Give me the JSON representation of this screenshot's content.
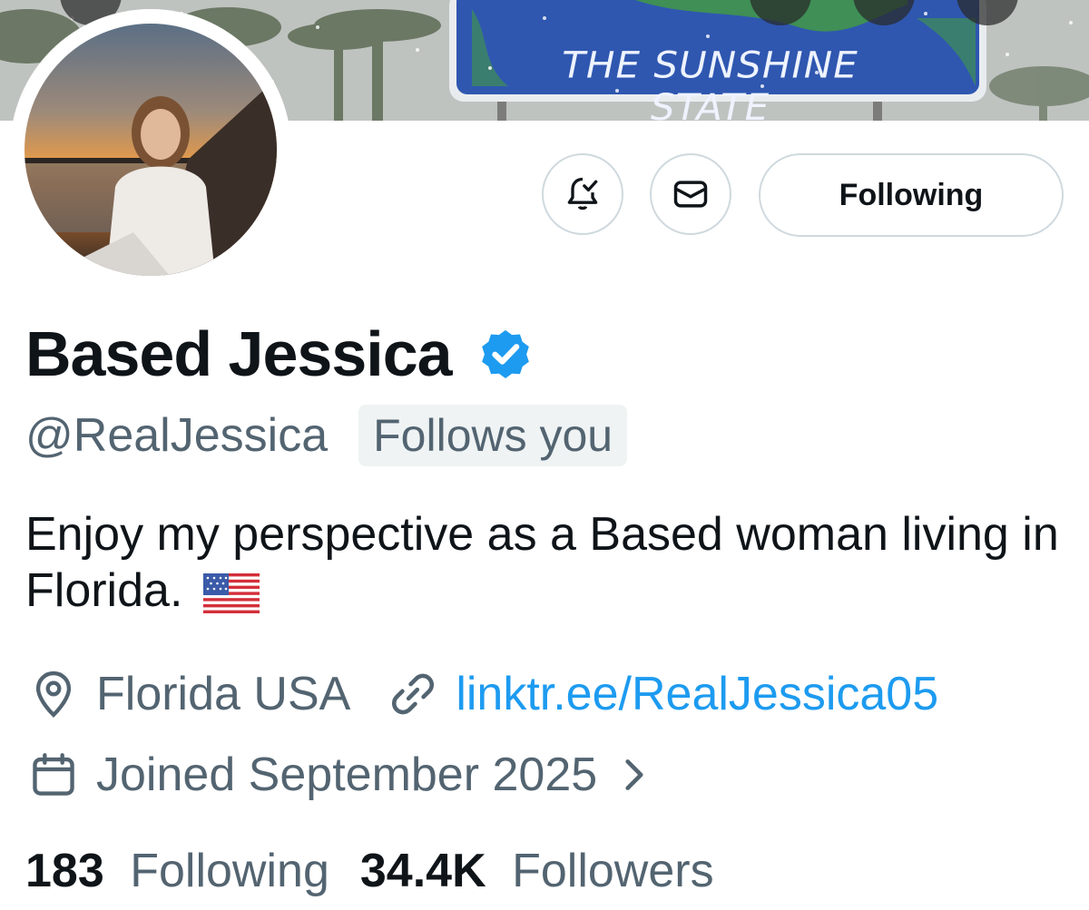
{
  "banner": {
    "sign_text": "THE SUNSHINE STATE"
  },
  "actions": {
    "notify_icon": "bell-check-icon",
    "message_icon": "envelope-icon",
    "follow_label": "Following"
  },
  "profile": {
    "display_name": "Based Jessica",
    "verified": true,
    "handle": "@RealJessica",
    "follows_you": "Follows you",
    "bio": "Enjoy my perspective as a Based woman living in Florida.",
    "location": "Florida USA",
    "link": "linktr.ee/RealJessica05",
    "joined": "Joined September 2025"
  },
  "stats": {
    "following_count": "183",
    "following_label": "Following",
    "followers_count": "34.4K",
    "followers_label": "Followers"
  },
  "colors": {
    "accent": "#1d9bf0",
    "secondary_text": "#536471",
    "primary_text": "#0f1419",
    "border": "#cfd9de",
    "badge_bg": "#eff3f4"
  }
}
